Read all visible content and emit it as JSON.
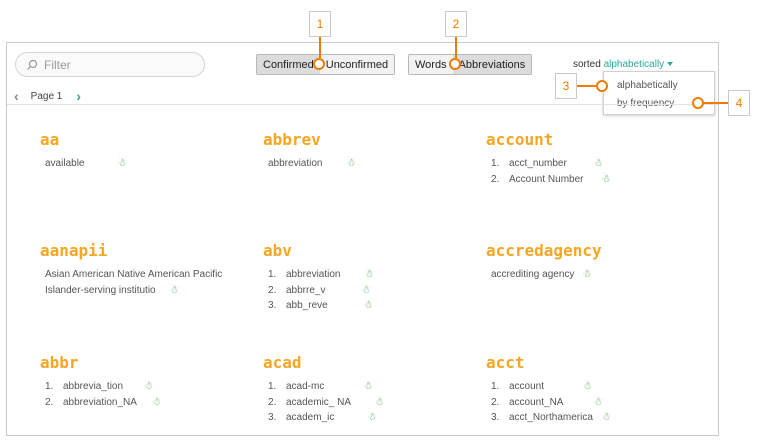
{
  "filter": {
    "placeholder": "Filter"
  },
  "toggle_confirm": {
    "confirmed": "Confirmed",
    "unconfirmed": "Unconfirmed"
  },
  "toggle_type": {
    "words": "Words",
    "abbreviations": "Abbreviations"
  },
  "sort": {
    "label": "sorted",
    "value": "alphabetically"
  },
  "sort_menu": {
    "options": [
      "alphabetically",
      "by frequency"
    ]
  },
  "pager": {
    "label": "Page 1"
  },
  "callouts": [
    "1",
    "2",
    "3",
    "4"
  ],
  "entries": [
    {
      "word": "aa",
      "defs": [
        "available"
      ]
    },
    {
      "word": "abbrev",
      "defs": [
        "abbreviation"
      ]
    },
    {
      "word": "account",
      "defs": [
        "acct_number",
        "Account Number"
      ]
    },
    {
      "word": "aanapii",
      "defs": [
        "Asian American Native American Pacific",
        "Islander-serving institutio"
      ]
    },
    {
      "word": "abv",
      "defs": [
        "abbreviation",
        "abbrre_v",
        "abb_reve"
      ]
    },
    {
      "word": "accredagency",
      "defs": [
        "accrediting agency"
      ]
    },
    {
      "word": "abbr",
      "defs": [
        "abbrevia_tion",
        "abbreviation_NA"
      ]
    },
    {
      "word": "acad",
      "defs": [
        "acad-mc",
        "academic_ NA",
        "academ_ic"
      ]
    },
    {
      "word": "acct",
      "defs": [
        "account",
        "account_NA",
        "acct_Northamerica"
      ]
    }
  ],
  "colors": {
    "accent": "#2ba89a",
    "word": "#f5a623",
    "callout": "#f07b00",
    "robot": "#4aa14a"
  },
  "icons": {
    "filter": "search-icon",
    "robot": "robot-icon",
    "prev": "chevron-left-icon",
    "next": "chevron-right-icon"
  }
}
